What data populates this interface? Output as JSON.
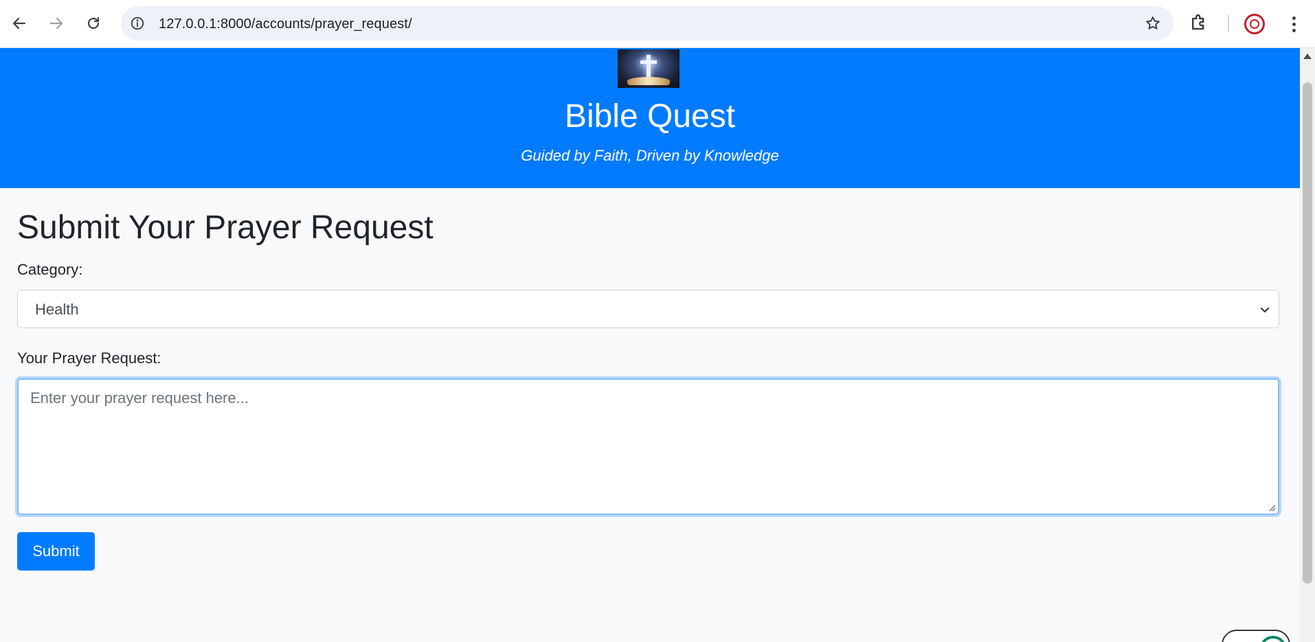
{
  "browser": {
    "url": "127.0.0.1:8000/accounts/prayer_request/",
    "icons": [
      "back-arrow-icon",
      "forward-arrow-icon",
      "reload-icon",
      "site-info-icon",
      "bookmark-star-icon",
      "extensions-icon",
      "profile-avatar",
      "more-menu-icon"
    ]
  },
  "header": {
    "logo": "cross-and-bible-logo",
    "title": "Bible Quest",
    "tagline": "Guided by Faith, Driven by Knowledge",
    "background_color": "#007bff"
  },
  "form": {
    "heading": "Submit Your Prayer Request",
    "category_label": "Category:",
    "category_selected": "Health",
    "request_label": "Your Prayer Request:",
    "request_placeholder": "Enter your prayer request here...",
    "submit_label": "Submit"
  },
  "colors": {
    "accent": "#007bff",
    "page_background": "#f8f9fa",
    "text": "#212529"
  }
}
